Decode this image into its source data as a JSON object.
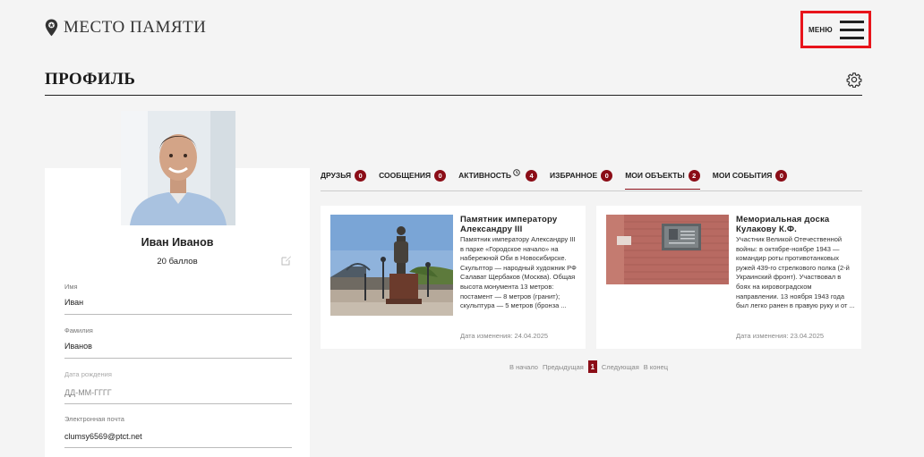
{
  "header": {
    "logo_text": "МЕСТО ПАМЯТИ",
    "menu_label": "МЕНЮ"
  },
  "page": {
    "title": "ПРОФИЛЬ"
  },
  "profile": {
    "name": "Иван Иванов",
    "points": "20 баллов",
    "fields": [
      {
        "label": "Имя",
        "value": "Иван",
        "placeholder": ""
      },
      {
        "label": "Фамилия",
        "value": "Иванов",
        "placeholder": ""
      },
      {
        "label": "Дата рождения",
        "value": "",
        "placeholder": "ДД-ММ-ГГГГ"
      },
      {
        "label": "Электронная почта",
        "value": "clumsy6569@ptct.net",
        "placeholder": ""
      }
    ]
  },
  "tabs": [
    {
      "label": "ДРУЗЬЯ",
      "count": "0"
    },
    {
      "label": "СООБЩЕНИЯ",
      "count": "0"
    },
    {
      "label": "АКТИВНОСТЬ",
      "count": "4"
    },
    {
      "label": "ИЗБРАННОЕ",
      "count": "0"
    },
    {
      "label": "МОИ ОБЪЕКТЫ",
      "count": "2"
    },
    {
      "label": "МОИ СОБЫТИЯ",
      "count": "0"
    }
  ],
  "objects": [
    {
      "title": "Памятник императору Александру III",
      "text": "Памятник императору Александру III в парке «Городское начало» на набережной Оби в Новосибирске. Скульптор — народный художник РФ Салават Щербаков (Москва). Общая высота монумента 13 метров: постамент — 8 метров (гранит); скульптура — 5 метров (бронза ...",
      "date": "Дата изменения: 24.04.2025"
    },
    {
      "title": "Мемориальная доска Кулакову К.Ф.",
      "text": "Участник Великой Отечественной войны: в октябре-ноябре 1943 — командир роты противотанковых ружей 439-го стрелкового полка (2-й Украинский фронт). Участвовал в боях на кировоградском направлении. 13 ноября 1943 года был легко ранен в правую руку и от ...",
      "date": "Дата изменения: 23.04.2025"
    }
  ],
  "pager": {
    "first": "В начало",
    "prev": "Предыдущая",
    "current": "1",
    "next": "Следующая",
    "last": "В конец"
  },
  "colors": {
    "accent": "#8b0d17",
    "highlight": "#e8141b"
  },
  "active_tab": "МОИ ОБЪЕКТЫ"
}
